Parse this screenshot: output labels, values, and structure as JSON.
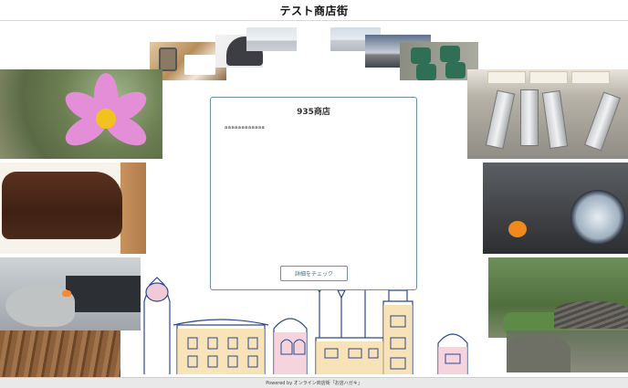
{
  "header": {
    "title": "テスト商店街"
  },
  "shop_card": {
    "name": "935商店",
    "description": "aaaaaaaaaaaa",
    "details_button": "詳細をチェック"
  },
  "footer": {
    "powered_by": "Powered by オンライン商店街「お店ハガキ」"
  },
  "colors": {
    "card_border": "#6c8fa8",
    "button_text": "#3f6e90"
  }
}
